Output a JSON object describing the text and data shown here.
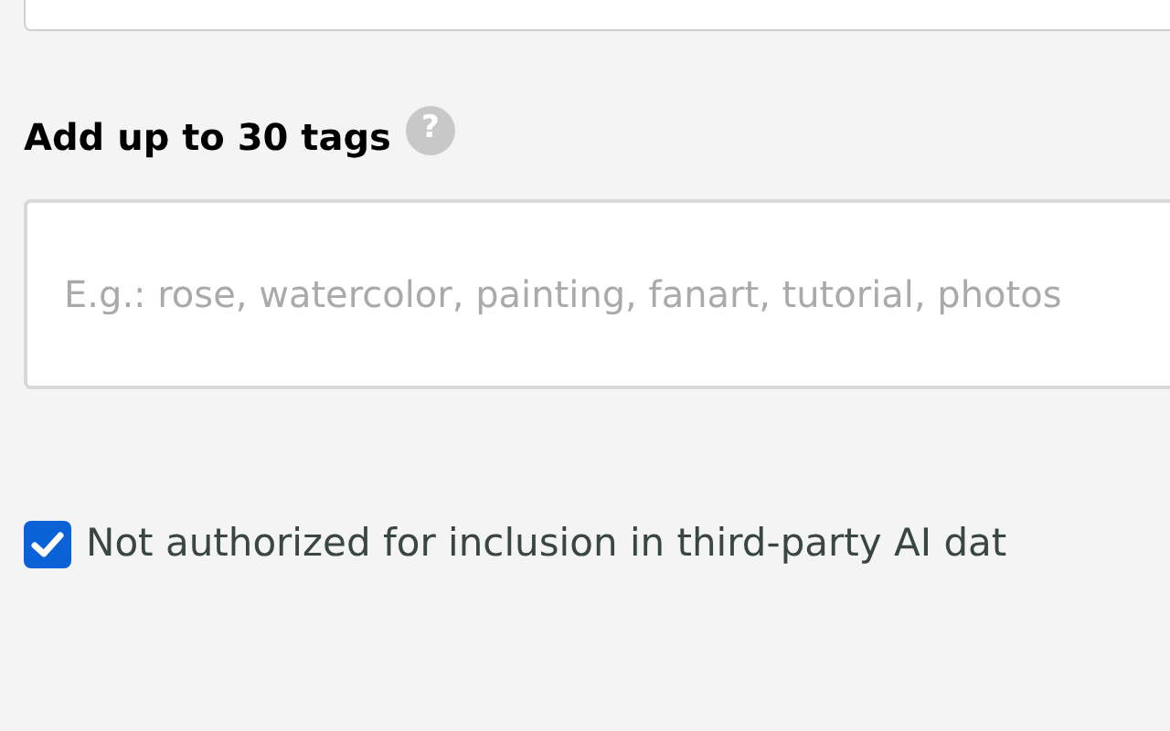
{
  "tags_section": {
    "heading": "Add up to 30 tags",
    "help_icon": "?",
    "field": {
      "placeholder": "E.g.: rose, watercolor, painting, fanart, tutorial, photos"
    }
  },
  "ai_opt_out": {
    "label": "Not authorized for inclusion in third-party AI dat",
    "checked": true
  }
}
